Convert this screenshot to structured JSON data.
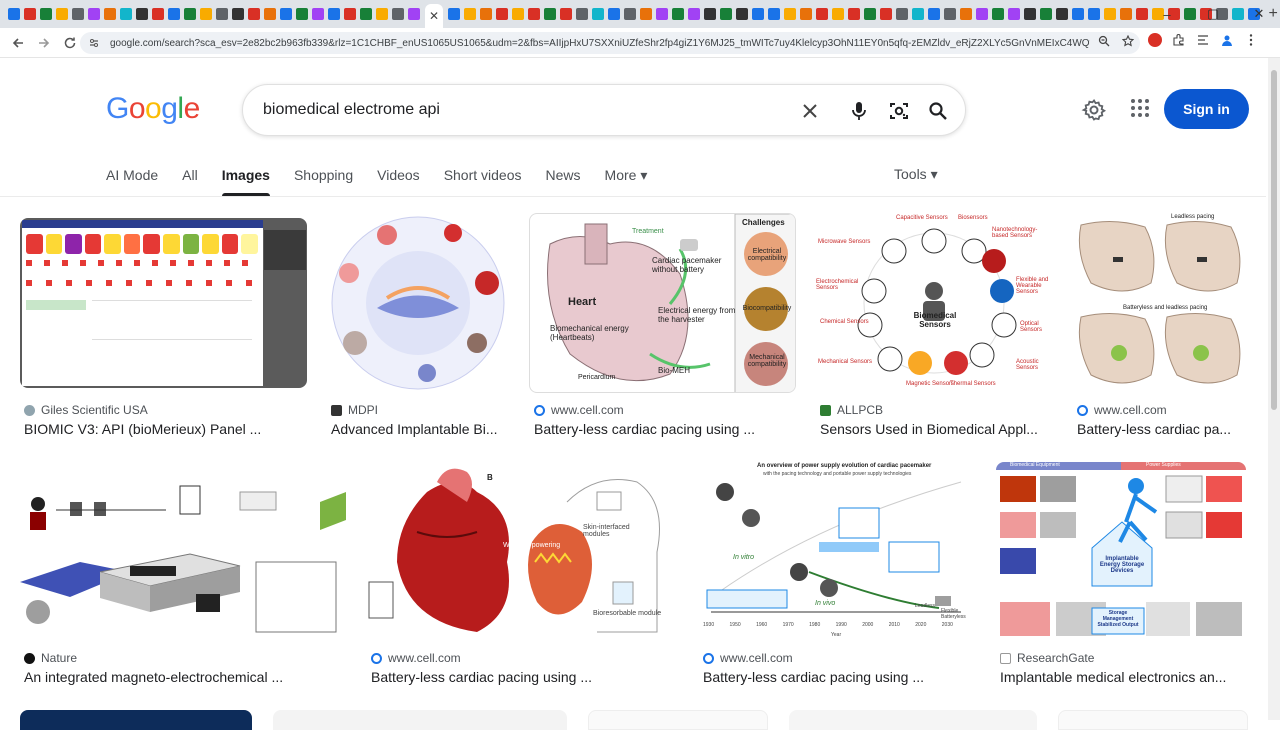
{
  "browser": {
    "url": "google.com/search?sca_esv=2e82bc2b963fb339&rlz=1C1CHBF_enUS1065US1065&udm=2&fbs=AIIjpHxU7SXXniUZfeShr2fp4giZ1Y6MJ25_tmWITc7uy4Klelcyp3OhN11EY0n5qfq-zEMZldv_eRjZ2XLYc5GnVnMEIxC4WQfoNDH7FwchyAaypSF...",
    "window_controls": [
      "–",
      "▢",
      "✕"
    ],
    "new_tab": "+"
  },
  "logo": "Google",
  "search": {
    "query": "biomedical electrome api"
  },
  "header": {
    "signin_label": "Sign in"
  },
  "tabs": [
    {
      "label": "AI Mode"
    },
    {
      "label": "All"
    },
    {
      "label": "Images"
    },
    {
      "label": "Shopping"
    },
    {
      "label": "Videos"
    },
    {
      "label": "Short videos"
    },
    {
      "label": "News"
    },
    {
      "label": "More ▾"
    }
  ],
  "tools_label": "Tools ▾",
  "results": [
    {
      "source": "Giles Scientific USA",
      "title": "BIOMIC V3: API (bioMerieux) Panel ..."
    },
    {
      "source": "MDPI",
      "title": "Advanced Implantable Bi..."
    },
    {
      "source": "www.cell.com",
      "title": "Battery-less cardiac pacing using ..."
    },
    {
      "source": "ALLPCB",
      "title": "Sensors Used in Biomedical Appl..."
    },
    {
      "source": "www.cell.com",
      "title": "Battery-less cardiac pa..."
    },
    {
      "source": "Nature",
      "title": "An integrated magneto-electrochemical ..."
    },
    {
      "source": "www.cell.com",
      "title": "Battery-less cardiac pacing using ..."
    },
    {
      "source": "www.cell.com",
      "title": "Battery-less cardiac pacing using ..."
    },
    {
      "source": "ResearchGate",
      "title": "Implantable medical electronics an..."
    }
  ],
  "thumb_text": {
    "heart_label": "Heart",
    "heart_energy": "Biomechanical energy (Heartbeats)",
    "heart_pacemaker": "Cardiac pacemaker without battery",
    "heart_harvester": "Electrical energy from the harvester",
    "heart_treatment": "Treatment",
    "heart_pericardium": "Pericardium",
    "heart_bio": "Bio-MEH",
    "challenges": "Challenges",
    "challenge_1": "Electrical compatibility",
    "challenge_2": "Biocompatibility",
    "challenge_3": "Mechanical compatibility",
    "sensors_center": "Biomedical Sensors",
    "sensor_labels": [
      "Capacitive Sensors",
      "Biosensors",
      "Nanotechnology-based Sensors",
      "Microwave Sensors",
      "Flexible and Wearable Sensors",
      "Electrochemical Sensors",
      "Optical Sensors",
      "Chemical Sensors",
      "Acoustic Sensors",
      "Mechanical Sensors",
      "Thermal Sensors",
      "Magnetic Sensors"
    ],
    "leadless_title": "Leadless pacing",
    "batteryless_title": "Batteryless and leadless pacing",
    "wireless_label": "Wireless powering",
    "skin_label": "Skin-interfaced modules",
    "bio_label": "Bioresorbable module",
    "timeline_title": "An overview of power supply evolution of cardiac pacemaker",
    "timeline_subtitle": "with the pacing technology and portable power supply technologies",
    "timeline_invitro": "In vitro",
    "timeline_invivo": "In vivo",
    "timeline_leadless": "Leadless",
    "timeline_flexible": "Flexible Batteryless",
    "timeline_year": "Year",
    "timeline_ticks": [
      "1930",
      "1950",
      "1960",
      "1970",
      "1980",
      "1990",
      "2000",
      "2010",
      "2020",
      "2030"
    ],
    "rg_header_left": "Biomedical Equipment",
    "rg_header_right": "Power Supplies",
    "rg_center": "Implantable Energy Storage Devices",
    "rg_bottom": "Storage Management Stabilized Output",
    "panel_b": "B"
  },
  "colors": {
    "google_blue": "#4285F4",
    "google_red": "#EA4335",
    "google_yellow": "#FBBC05",
    "google_green": "#34A853",
    "signin_bg": "#0b57d0"
  }
}
